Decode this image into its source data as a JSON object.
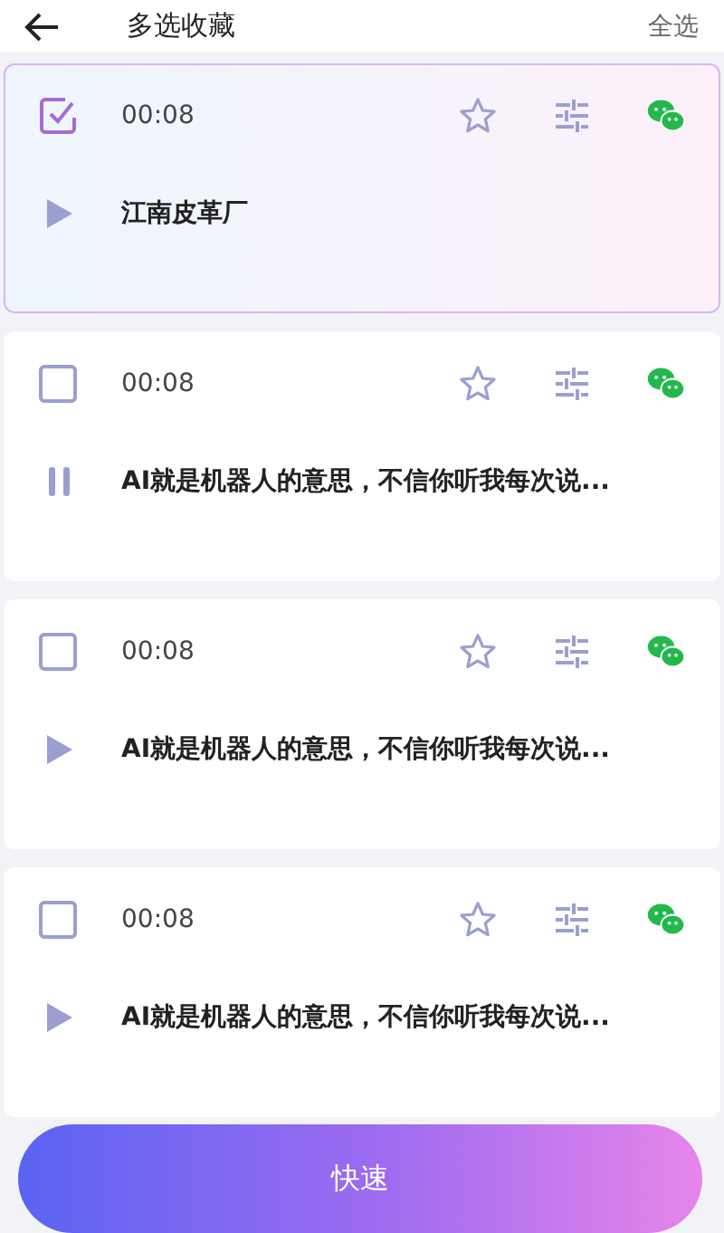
{
  "header": {
    "title": "多选收藏",
    "select_all": "全选"
  },
  "records": [
    {
      "selected": true,
      "duration": "00:08",
      "playing": false,
      "text": "江南皮革厂"
    },
    {
      "selected": false,
      "duration": "00:08",
      "playing": true,
      "text": "AI就是机器人的意思，不信你听我每次说..."
    },
    {
      "selected": false,
      "duration": "00:08",
      "playing": false,
      "text": "AI就是机器人的意思，不信你听我每次说..."
    },
    {
      "selected": false,
      "duration": "00:08",
      "playing": false,
      "text": "AI就是机器人的意思，不信你听我每次说..."
    }
  ],
  "action_button": {
    "label": "快速"
  }
}
